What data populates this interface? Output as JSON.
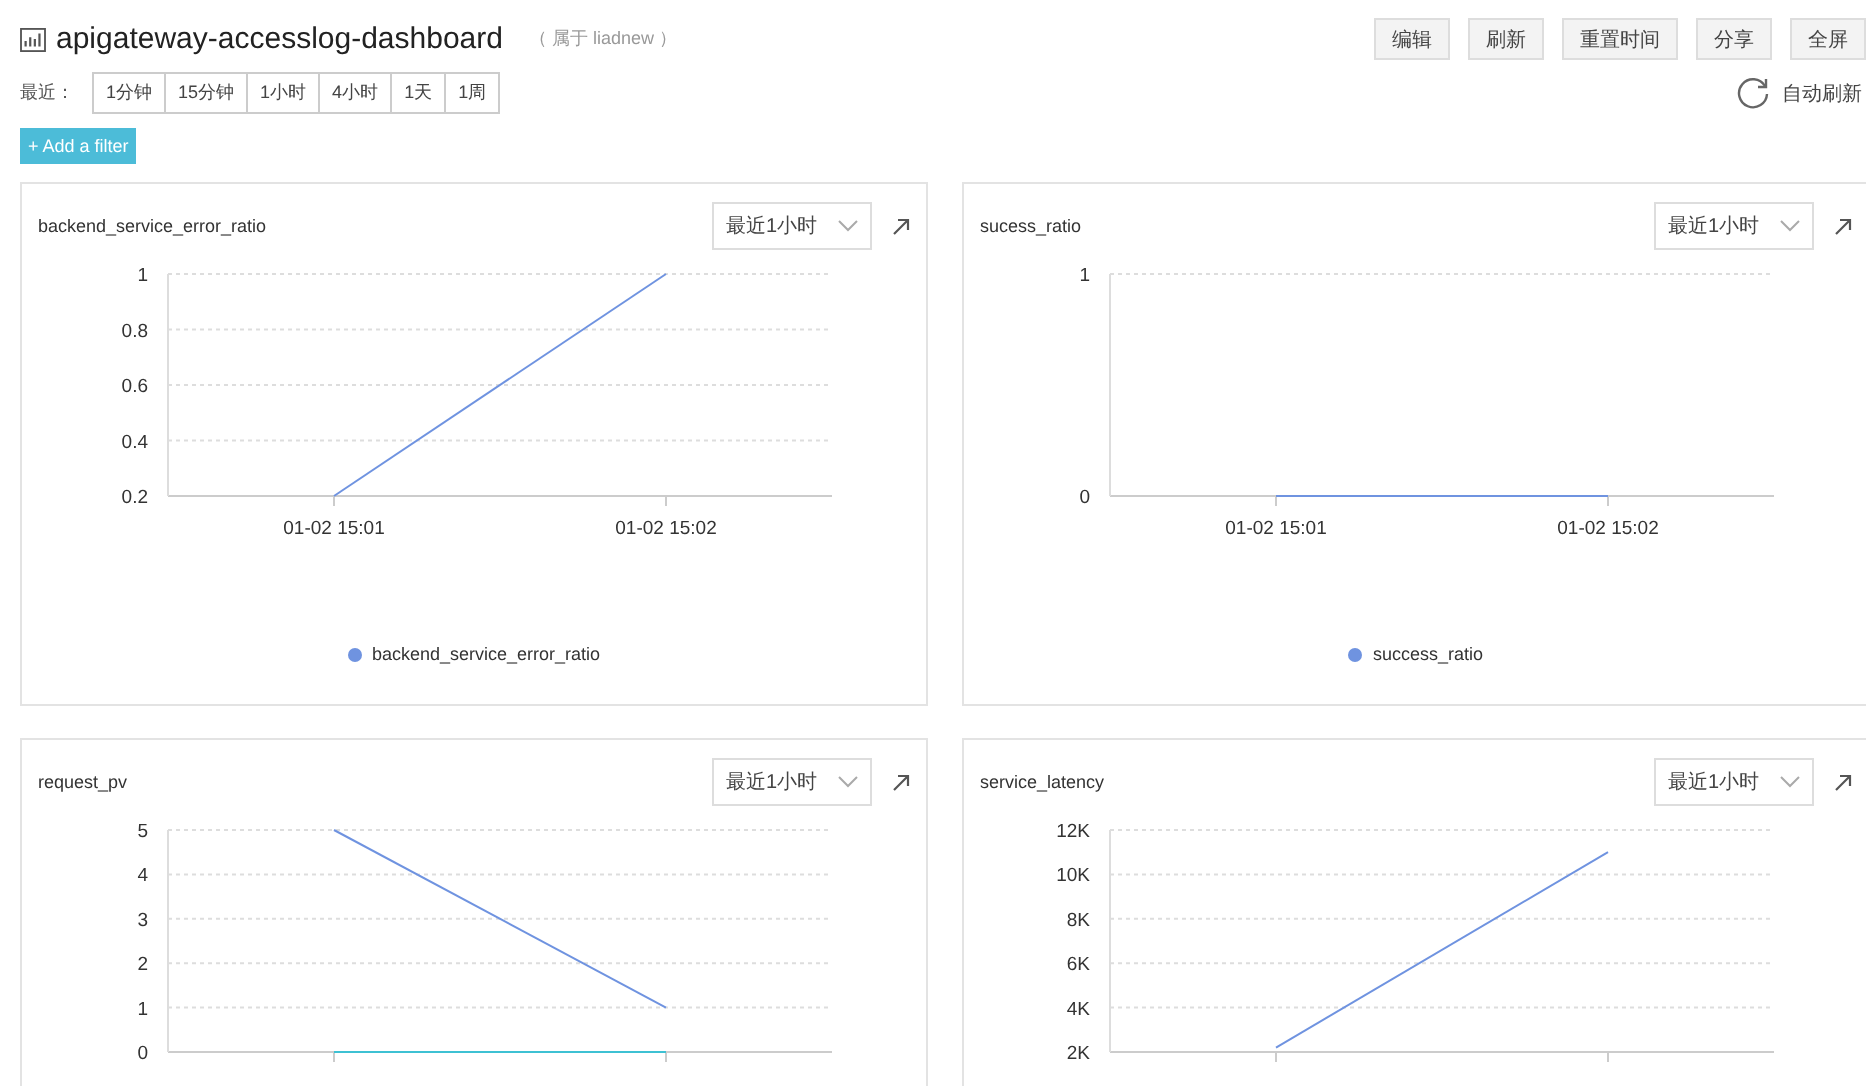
{
  "header": {
    "title": "apigateway-accesslog-dashboard",
    "owner": "（ 属于 liadnew ）",
    "buttons": [
      "编辑",
      "刷新",
      "重置时间",
      "分享",
      "全屏"
    ],
    "auto_refresh": "自动刷新"
  },
  "recent": {
    "label": "最近：",
    "ranges": [
      {
        "label": "1分钟",
        "selected": false
      },
      {
        "label": "15分钟",
        "selected": false
      },
      {
        "label": "1小时",
        "selected": false
      },
      {
        "label": "4小时",
        "selected": false
      },
      {
        "label": "1天",
        "selected": false
      },
      {
        "label": "1周",
        "selected": false
      }
    ]
  },
  "add_filter": "+ Add a filter",
  "panels": [
    {
      "title": "backend_service_error_ratio",
      "range": "最近1小时",
      "chart_data": {
        "type": "line",
        "grid": true,
        "categories": [
          "01-02 15:01",
          "01-02 15:02"
        ],
        "ylim": [
          0.2,
          1
        ],
        "yticks": [
          0.2,
          0.4,
          0.6,
          0.8,
          1
        ],
        "series": [
          {
            "name": "backend_service_error_ratio",
            "color": "#6f93e0",
            "values": [
              0.2,
              1
            ]
          }
        ]
      }
    },
    {
      "title": "sucess_ratio",
      "range": "最近1小时",
      "chart_data": {
        "type": "line",
        "grid": true,
        "categories": [
          "01-02 15:01",
          "01-02 15:02"
        ],
        "ylim": [
          0,
          1
        ],
        "yticks": [
          0,
          1
        ],
        "series": [
          {
            "name": "success_ratio",
            "color": "#6f93e0",
            "values": [
              0,
              0
            ]
          }
        ]
      }
    },
    {
      "title": "request_pv",
      "range": "最近1小时",
      "chart_data": {
        "type": "line",
        "grid": true,
        "categories": [
          null,
          null
        ],
        "ylim": [
          0,
          5
        ],
        "yticks": [
          0,
          1,
          2,
          3,
          4,
          5
        ],
        "series": [
          {
            "color": "#6f93e0",
            "values": [
              5,
              1
            ]
          },
          {
            "color": "#3ec1d3",
            "values": [
              0,
              0
            ]
          }
        ]
      }
    },
    {
      "title": "service_latency",
      "range": "最近1小时",
      "chart_data": {
        "type": "line",
        "grid": true,
        "categories": [
          null,
          null
        ],
        "ylim": [
          2000,
          12000
        ],
        "yticks": [
          {
            "value": 2000,
            "label": "2K"
          },
          {
            "value": 4000,
            "label": "4K"
          },
          {
            "value": 6000,
            "label": "6K"
          },
          {
            "value": 8000,
            "label": "8K"
          },
          {
            "value": 10000,
            "label": "10K"
          },
          {
            "value": 12000,
            "label": "12K"
          }
        ],
        "series": [
          {
            "color": "#6f93e0",
            "values": [
              2200,
              11000
            ]
          }
        ]
      }
    }
  ]
}
